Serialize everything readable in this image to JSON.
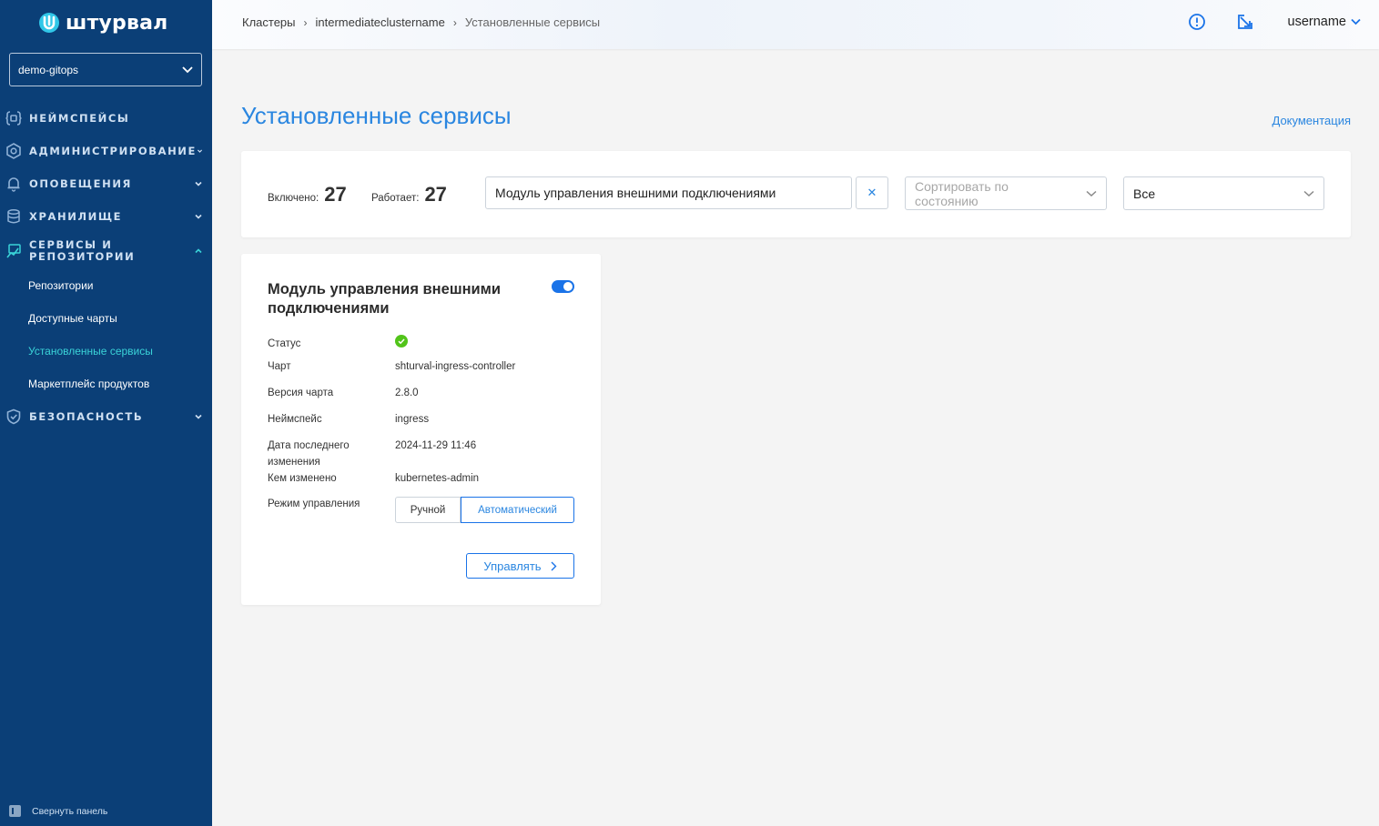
{
  "app": {
    "logo_text": "штурвал"
  },
  "sidebar": {
    "cluster": "demo-gitops",
    "items": [
      {
        "label": "НЕЙМСПЕЙСЫ",
        "icon": "namespace-braces-icon"
      },
      {
        "label": "АДМИНИСТРИРОВАНИЕ",
        "icon": "gear-hex-icon"
      },
      {
        "label": "ОПОВЕЩЕНИЯ",
        "icon": "bell-icon"
      },
      {
        "label": "ХРАНИЛИЩЕ",
        "icon": "database-icon"
      },
      {
        "label": "СЕРВИСЫ И РЕПОЗИТОРИИ",
        "icon": "services-icon"
      },
      {
        "label": "БЕЗОПАСНОСТЬ",
        "icon": "shield-check-icon"
      }
    ],
    "subitems": [
      {
        "label": "Репозитории"
      },
      {
        "label": "Доступные чарты"
      },
      {
        "label": "Установленные сервисы"
      },
      {
        "label": "Маркетплейс продуктов"
      }
    ],
    "collapse_label": "Свернуть панель",
    "colors": {
      "background": "#0b3f77",
      "active": "#3ad3d8"
    }
  },
  "header": {
    "breadcrumb": [
      "Кластеры",
      "intermediateclustername",
      "Установленные сервисы"
    ],
    "username": "username"
  },
  "main": {
    "title": "Установленные сервисы",
    "doc_link": "Документация",
    "stats": {
      "enabled_label": "Включено:",
      "enabled_value": "27",
      "running_label": "Работает:",
      "running_value": "27"
    },
    "search_value": "Модуль управления внешними подключениями",
    "clear_label": "✕",
    "sort_placeholder": "Сортировать по состоянию",
    "filter_value": "Все"
  },
  "card": {
    "title": "Модуль управления внешними подключениями",
    "enabled": true,
    "status_label": "Статус",
    "status": "ok",
    "chart_label": "Чарт",
    "chart_value": "shturval-ingress-controller",
    "version_label": "Версия чарта",
    "version_value": "2.8.0",
    "namespace_label": "Неймспейс",
    "namespace_value": "ingress",
    "modified_label": "Дата последнего изменения",
    "modified_value": "2024-11-29 11:46",
    "modified_by_label": "Кем изменено",
    "modified_by_value": "kubernetes-admin",
    "mode_label": "Режим управления",
    "mode_options": [
      "Ручной",
      "Автоматический"
    ],
    "mode_selected": "Автоматический",
    "manage_button": "Управлять",
    "accent_color": "#1a73e8"
  }
}
